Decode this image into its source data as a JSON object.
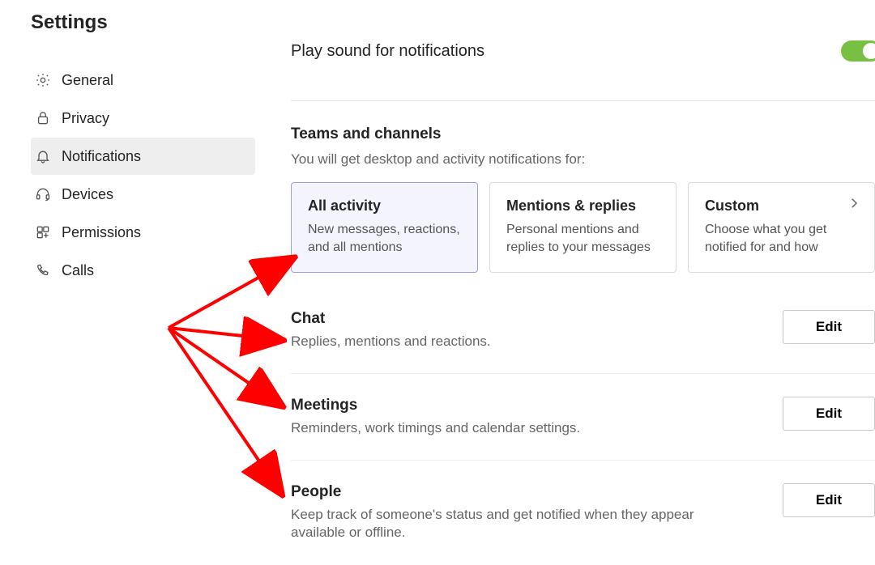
{
  "header": {
    "title": "Settings"
  },
  "sidebar": {
    "items": [
      {
        "label": "General",
        "active": false
      },
      {
        "label": "Privacy",
        "active": false
      },
      {
        "label": "Notifications",
        "active": true
      },
      {
        "label": "Devices",
        "active": false
      },
      {
        "label": "Permissions",
        "active": false
      },
      {
        "label": "Calls",
        "active": false
      }
    ]
  },
  "sound": {
    "label": "Play sound for notifications",
    "on": true
  },
  "teams": {
    "title": "Teams and channels",
    "subtitle": "You will get desktop and activity notifications for:",
    "cards": [
      {
        "title": "All activity",
        "desc": "New messages, reactions, and all mentions",
        "selected": true
      },
      {
        "title": "Mentions & replies",
        "desc": "Personal mentions and replies to your messages",
        "selected": false
      },
      {
        "title": "Custom",
        "desc": "Choose what you get notified for and how",
        "selected": false,
        "chevron": true
      }
    ]
  },
  "sections": {
    "chat": {
      "title": "Chat",
      "desc": "Replies, mentions and reactions.",
      "edit_label": "Edit"
    },
    "meetings": {
      "title": "Meetings",
      "desc": "Reminders, work timings and calendar settings.",
      "edit_label": "Edit"
    },
    "people": {
      "title": "People",
      "desc": "Keep track of someone's status and get notified when they appear available or offline.",
      "edit_label": "Edit"
    }
  }
}
